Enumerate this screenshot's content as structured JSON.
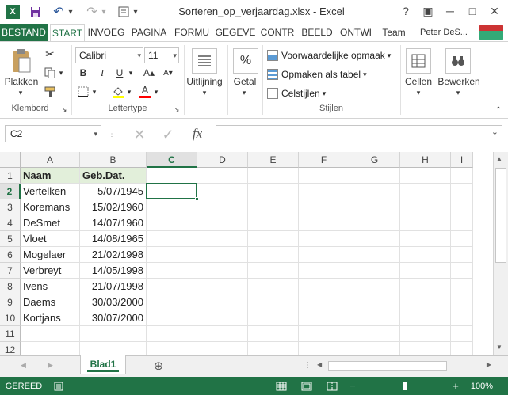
{
  "window": {
    "title": "Sorteren_op_verjaardag.xlsx - Excel",
    "help": "?",
    "restore": "▣",
    "minimize": "─",
    "maximize": "□",
    "close": "✕"
  },
  "qat": {
    "save": "💾",
    "undo": "↶",
    "redo": "↷",
    "undo_dd": "▾",
    "redo_dd": "▾",
    "custom": "▾"
  },
  "tabs": {
    "file": "BESTAND",
    "start": "START",
    "insert": "INVOEG",
    "page": "PAGINA",
    "formulas": "FORMU",
    "data": "GEGEVE",
    "review": "CONTR",
    "view": "BEELD",
    "dev": "ONTWI",
    "team": "Team",
    "user": "Peter DeS..."
  },
  "ribbon": {
    "clipboard": {
      "paste": "Plakken",
      "label": "Klembord"
    },
    "font": {
      "name": "Calibri",
      "size": "11",
      "bold": "B",
      "italic": "I",
      "underline": "U",
      "grow": "A▴",
      "shrink": "A▾",
      "fontcolor": "A",
      "label": "Lettertype"
    },
    "alignment": {
      "label": "Uitlijning"
    },
    "number": {
      "label": "Getal",
      "symbol": "%"
    },
    "styles": {
      "conditional": "Voorwaardelijke opmaak",
      "as_table": "Opmaken als tabel",
      "cell_styles": "Celstijlen",
      "label": "Stijlen"
    },
    "cells": {
      "label": "Cellen"
    },
    "editing": {
      "label": "Bewerken"
    }
  },
  "formula_bar": {
    "name_box": "C2",
    "fx": "fx",
    "value": "",
    "cancel": "✕",
    "enter": "✓"
  },
  "columns": [
    "A",
    "B",
    "C",
    "D",
    "E",
    "F",
    "G",
    "H",
    "I"
  ],
  "rows": [
    "1",
    "2",
    "3",
    "4",
    "5",
    "6",
    "7",
    "8",
    "9",
    "10",
    "11",
    "12"
  ],
  "table": {
    "header": [
      "Naam",
      "Geb.Dat."
    ],
    "data": [
      [
        "Vertelken",
        "5/07/1945"
      ],
      [
        "Koremans",
        "15/02/1960"
      ],
      [
        "DeSmet",
        "14/07/1960"
      ],
      [
        "Vloet",
        "14/08/1965"
      ],
      [
        "Mogelaer",
        "21/02/1998"
      ],
      [
        "Verbreyt",
        "14/05/1998"
      ],
      [
        "Ivens",
        "21/07/1998"
      ],
      [
        "Daems",
        "30/03/2000"
      ],
      [
        "Kortjans",
        "30/07/2000"
      ]
    ]
  },
  "active_cell": "C2",
  "sheets": {
    "active": "Blad1",
    "add": "⊕"
  },
  "status": {
    "ready": "GEREED",
    "zoom": "100%",
    "zoom_out": "−",
    "zoom_in": "+"
  },
  "colors": {
    "accent": "#217346",
    "header_fill": "#e2efda"
  }
}
